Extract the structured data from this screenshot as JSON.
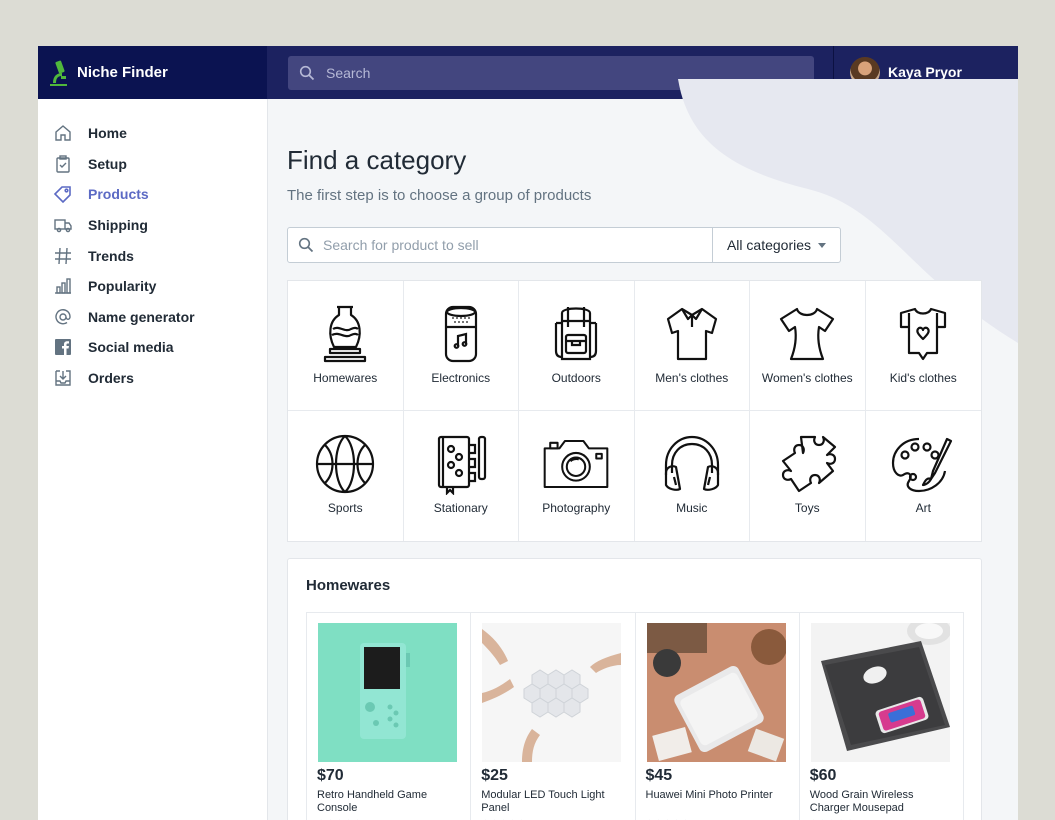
{
  "app": {
    "title": "Niche Finder"
  },
  "topbar": {
    "search_placeholder": "Search",
    "user_name": "Kaya Pryor"
  },
  "sidebar": {
    "items": [
      {
        "label": "Home",
        "icon": "home-icon"
      },
      {
        "label": "Setup",
        "icon": "clipboard-icon"
      },
      {
        "label": "Products",
        "icon": "tag-icon",
        "active": true
      },
      {
        "label": "Shipping",
        "icon": "truck-icon"
      },
      {
        "label": "Trends",
        "icon": "hashtag-icon"
      },
      {
        "label": "Popularity",
        "icon": "bar-chart-icon"
      },
      {
        "label": "Name generator",
        "icon": "at-sign-icon"
      },
      {
        "label": "Social media",
        "icon": "facebook-icon"
      },
      {
        "label": "Orders",
        "icon": "download-tray-icon"
      }
    ]
  },
  "main": {
    "title": "Find a category",
    "subtitle": "The first step is to choose a group of products",
    "search": {
      "placeholder": "Search for product to sell",
      "category_select": "All categories"
    },
    "categories": [
      {
        "label": "Homewares",
        "icon": "vase-icon"
      },
      {
        "label": "Electronics",
        "icon": "smart-speaker-icon"
      },
      {
        "label": "Outdoors",
        "icon": "backpack-icon"
      },
      {
        "label": "Men's clothes",
        "icon": "polo-shirt-icon"
      },
      {
        "label": "Women's clothes",
        "icon": "womens-top-icon"
      },
      {
        "label": "Kid's clothes",
        "icon": "baby-onesie-icon"
      },
      {
        "label": "Sports",
        "icon": "basketball-icon"
      },
      {
        "label": "Stationary",
        "icon": "notebook-icon"
      },
      {
        "label": "Photography",
        "icon": "camera-icon"
      },
      {
        "label": "Music",
        "icon": "headphones-icon"
      },
      {
        "label": "Toys",
        "icon": "puzzle-icon"
      },
      {
        "label": "Art",
        "icon": "palette-icon"
      }
    ],
    "products_panel": {
      "title": "Homewares",
      "products": [
        {
          "price": "$70",
          "name": "Retro Handheld Game Console",
          "stars": "★★★★★"
        },
        {
          "price": "$25",
          "name": "Modular LED Touch Light Panel",
          "stars": "★★★★★"
        },
        {
          "price": "$45",
          "name": "Huawei Mini Photo Printer",
          "stars": "★★★★★"
        },
        {
          "price": "$60",
          "name": "Wood Grain Wireless Charger Mousepad",
          "stars": "★★★★★"
        }
      ]
    }
  },
  "colors": {
    "brand_navy": "#0b1351",
    "topbar": "#1c2260",
    "accent": "#5c6ac4",
    "logo_green": "#50b83c"
  }
}
